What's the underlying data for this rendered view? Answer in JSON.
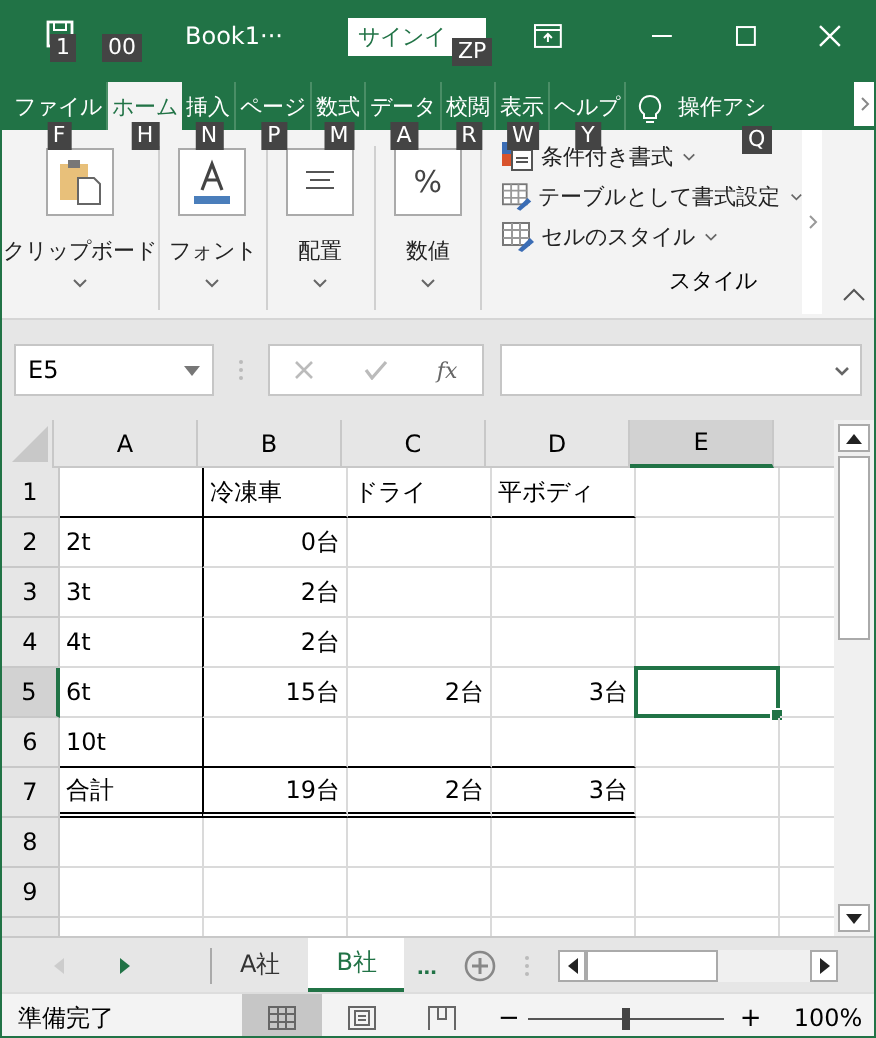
{
  "title_bar": {
    "save_key_tip": "1",
    "qat_key_tip": "00",
    "title": "Book1···",
    "sign_in": "サインイ",
    "sign_in_key_tip": "ZP"
  },
  "ribbon_tabs": [
    {
      "label": "ファイル",
      "key_tip": "F",
      "selected": false
    },
    {
      "label": "ホーム",
      "key_tip": "H",
      "selected": true
    },
    {
      "label": "挿入",
      "key_tip": "N",
      "selected": false
    },
    {
      "label": "ページ",
      "key_tip": "P",
      "selected": false
    },
    {
      "label": "数式",
      "key_tip": "M",
      "selected": false
    },
    {
      "label": "データ",
      "key_tip": "A",
      "selected": false
    },
    {
      "label": "校閲",
      "key_tip": "R",
      "selected": false
    },
    {
      "label": "表示",
      "key_tip": "W",
      "selected": false
    },
    {
      "label": "ヘルプ",
      "key_tip": "Y",
      "selected": false
    }
  ],
  "tell_me": {
    "label": "操作アシ",
    "key_tip": "Q"
  },
  "ribbon_groups": [
    {
      "kind": "clipboard",
      "label": "クリップボード"
    },
    {
      "kind": "font",
      "label": "フォント"
    },
    {
      "kind": "alignment",
      "label": "配置"
    },
    {
      "kind": "number",
      "label": "数値",
      "icon_text": "%"
    }
  ],
  "styles_group": {
    "label": "スタイル",
    "items": [
      {
        "kind": "conditional",
        "label": "条件付き書式"
      },
      {
        "kind": "table",
        "label": "テーブルとして書式設定"
      },
      {
        "kind": "cell",
        "label": "セルのスタイル"
      }
    ]
  },
  "formula_bar": {
    "name_box": "E5",
    "fx": "fx"
  },
  "columns": [
    {
      "label": "A",
      "selected": false
    },
    {
      "label": "B",
      "selected": false
    },
    {
      "label": "C",
      "selected": false
    },
    {
      "label": "D",
      "selected": false
    },
    {
      "label": "E",
      "selected": true
    }
  ],
  "rows": [
    {
      "label": "1",
      "selected": false,
      "cells": [
        {
          "border_bottom": true
        },
        {
          "text": "冷凍車",
          "kind": "text",
          "border_left": true,
          "border_bottom": true
        },
        {
          "text": "ドライ",
          "kind": "text",
          "border_bottom": true
        },
        {
          "text": "平ボディ",
          "kind": "text",
          "border_bottom": true
        },
        {}
      ]
    },
    {
      "label": "2",
      "selected": false,
      "cells": [
        {
          "text": "2t",
          "kind": "text"
        },
        {
          "text": "0台",
          "kind": "number",
          "border_left": true
        },
        {},
        {},
        {}
      ]
    },
    {
      "label": "3",
      "selected": false,
      "cells": [
        {
          "text": "3t",
          "kind": "text"
        },
        {
          "text": "2台",
          "kind": "number",
          "border_left": true
        },
        {},
        {},
        {}
      ]
    },
    {
      "label": "4",
      "selected": false,
      "cells": [
        {
          "text": "4t",
          "kind": "text"
        },
        {
          "text": "2台",
          "kind": "number",
          "border_left": true
        },
        {},
        {},
        {}
      ]
    },
    {
      "label": "5",
      "selected": true,
      "cells": [
        {
          "text": "6t",
          "kind": "text"
        },
        {
          "text": "15台",
          "kind": "number",
          "border_left": true
        },
        {
          "text": "2台",
          "kind": "number"
        },
        {
          "text": "3台",
          "kind": "number"
        },
        {}
      ]
    },
    {
      "label": "6",
      "selected": false,
      "cells": [
        {
          "text": "10t",
          "kind": "text",
          "border_bottom": true
        },
        {
          "border_left": true,
          "border_bottom": true
        },
        {
          "border_bottom": true
        },
        {
          "border_bottom": true
        },
        {}
      ]
    },
    {
      "label": "7",
      "selected": false,
      "cells": [
        {
          "text": "合計",
          "kind": "text",
          "double_border_bottom": true
        },
        {
          "text": "19台",
          "kind": "number",
          "border_left": true,
          "double_border_bottom": true
        },
        {
          "text": "2台",
          "kind": "number",
          "double_border_bottom": true
        },
        {
          "text": "3台",
          "kind": "number",
          "double_border_bottom": true
        },
        {}
      ]
    },
    {
      "label": "8",
      "selected": false,
      "cells": [
        {},
        {},
        {},
        {},
        {}
      ]
    },
    {
      "label": "9",
      "selected": false,
      "cells": [
        {},
        {},
        {},
        {},
        {}
      ]
    }
  ],
  "sheet_tabs": [
    {
      "label": "A社",
      "selected": false
    },
    {
      "label": "B社",
      "selected": true
    }
  ],
  "more_sheets": "...",
  "status_bar": {
    "status": "準備完了",
    "views": [
      {
        "kind": "normal",
        "selected": true
      },
      {
        "kind": "page_layout",
        "selected": false
      },
      {
        "kind": "page_break",
        "selected": false
      }
    ],
    "zoom": {
      "minus": "−",
      "plus": "+",
      "level": 0.5,
      "percent": "100%"
    }
  }
}
